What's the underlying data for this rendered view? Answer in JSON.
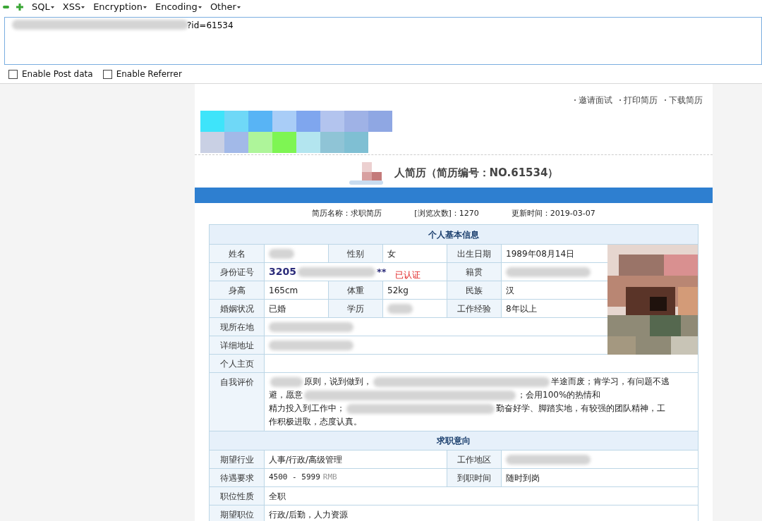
{
  "hackbar": {
    "menus": [
      {
        "label": "SQL"
      },
      {
        "label": "XSS"
      },
      {
        "label": "Encryption"
      },
      {
        "label": "Encoding"
      },
      {
        "label": "Other"
      }
    ],
    "url": {
      "visible_text": "?id=61534"
    },
    "options": [
      {
        "label": "Enable Post data",
        "checked": false
      },
      {
        "label": "Enable Referrer",
        "checked": false
      }
    ]
  },
  "resume": {
    "actions": [
      "邀请面试",
      "打印简历",
      "下载简历"
    ],
    "title": "人简历（简历编号：NO.61534）",
    "summary": [
      "简历名称：求职简历",
      "[浏览次数]：1270",
      "更新时间：2019-03-07"
    ],
    "sections": [
      {
        "title": "个人基本信息",
        "rows": [
          [
            {
              "kind": "label",
              "text": "姓名"
            },
            {
              "kind": "redacted"
            },
            {
              "kind": "label",
              "text": "性别"
            },
            {
              "kind": "text",
              "text": "女"
            },
            {
              "kind": "label",
              "text": "出生日期"
            },
            {
              "kind": "text",
              "text": "1989年08月14日"
            }
          ],
          [
            {
              "kind": "label",
              "text": "身份证号"
            },
            {
              "kind": "id",
              "prefix": "3205",
              "suffix": "**",
              "badge": "已认证"
            },
            {
              "kind": "merged"
            },
            {
              "kind": "merged"
            },
            {
              "kind": "label",
              "text": "籍贯"
            },
            {
              "kind": "redacted"
            }
          ],
          [
            {
              "kind": "label",
              "text": "身高"
            },
            {
              "kind": "text",
              "text": "165cm"
            },
            {
              "kind": "label",
              "text": "体重"
            },
            {
              "kind": "text",
              "text": "52kg"
            },
            {
              "kind": "label",
              "text": "民族"
            },
            {
              "kind": "text",
              "text": "汉"
            }
          ],
          [
            {
              "kind": "label",
              "text": "婚姻状况"
            },
            {
              "kind": "text",
              "text": "已婚"
            },
            {
              "kind": "label",
              "text": "学历"
            },
            {
              "kind": "redacted"
            },
            {
              "kind": "label",
              "text": "工作经验"
            },
            {
              "kind": "text",
              "text": "8年以上"
            }
          ],
          [
            {
              "kind": "label",
              "text": "现所在地"
            },
            {
              "kind": "redacted"
            },
            {
              "kind": "merged"
            },
            {
              "kind": "merged"
            },
            {
              "kind": "merged"
            },
            {
              "kind": "merged"
            }
          ],
          [
            {
              "kind": "label",
              "text": "详细地址"
            },
            {
              "kind": "redacted"
            },
            {
              "kind": "merged"
            },
            {
              "kind": "merged"
            },
            {
              "kind": "merged"
            },
            {
              "kind": "merged"
            }
          ],
          [
            {
              "kind": "label",
              "text": "个人主页"
            },
            {
              "kind": "empty"
            },
            {
              "kind": "merged"
            },
            {
              "kind": "merged"
            },
            {
              "kind": "merged"
            },
            {
              "kind": "merged"
            }
          ],
          [
            {
              "kind": "label",
              "text": "自我评价"
            },
            {
              "kind": "paragraph",
              "lines": [
                [
                  {
                    "kind": "blur"
                  },
                  {
                    "kind": "text",
                    "text": "原则，说到做到，"
                  },
                  {
                    "kind": "blur"
                  },
                  {
                    "kind": "text",
                    "text": "半途而废；肯学习，有问题不逃"
                  }
                ],
                [
                  {
                    "kind": "text",
                    "text": "避，愿意"
                  },
                  {
                    "kind": "blur"
                  },
                  {
                    "kind": "text",
                    "text": "；会用100%的热情和"
                  }
                ],
                [
                  {
                    "kind": "text",
                    "text": "精力投入到工作中；"
                  },
                  {
                    "kind": "blur"
                  },
                  {
                    "kind": "text",
                    "text": "勤奋好学、脚踏实地，有较强的团队精神，工"
                  }
                ],
                [
                  {
                    "kind": "text",
                    "text": "作积极进取，态度认真。"
                  }
                ]
              ]
            },
            {
              "kind": "merged"
            },
            {
              "kind": "merged"
            },
            {
              "kind": "merged"
            },
            {
              "kind": "merged"
            }
          ]
        ]
      },
      {
        "title": "求职意向",
        "rows": [
          [
            {
              "kind": "label",
              "text": "期望行业"
            },
            {
              "kind": "text",
              "text": "人事/行政/高级管理"
            },
            {
              "kind": "merged"
            },
            {
              "kind": "merged"
            },
            {
              "kind": "label",
              "text": "工作地区"
            },
            {
              "kind": "redacted"
            }
          ],
          [
            {
              "kind": "label",
              "text": "待遇要求"
            },
            {
              "kind": "salary",
              "text": "4500 - 5999",
              "unit": "RMB"
            },
            {
              "kind": "merged"
            },
            {
              "kind": "merged"
            },
            {
              "kind": "label",
              "text": "到职时间"
            },
            {
              "kind": "text",
              "text": "随时到岗"
            }
          ],
          [
            {
              "kind": "label",
              "text": "职位性质"
            },
            {
              "kind": "text",
              "text": "全职"
            },
            {
              "kind": "merged"
            },
            {
              "kind": "merged"
            },
            {
              "kind": "merged"
            },
            {
              "kind": "merged"
            }
          ],
          [
            {
              "kind": "label",
              "text": "期望职位"
            },
            {
              "kind": "text",
              "text": "行政/后勤，人力资源"
            },
            {
              "kind": "merged"
            },
            {
              "kind": "merged"
            },
            {
              "kind": "merged"
            },
            {
              "kind": "merged"
            }
          ]
        ]
      }
    ]
  }
}
